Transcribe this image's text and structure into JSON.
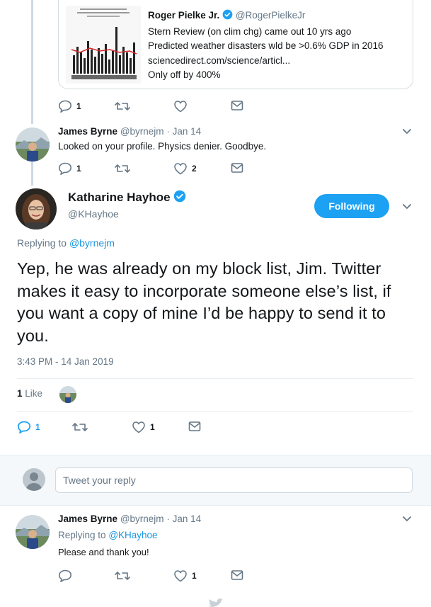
{
  "quoted_tweet": {
    "name": "Roger Pielke Jr.",
    "handle": "@RogerPielkeJr",
    "lines": [
      "Stern Review (on clim chg) came out 10 yrs ago",
      "Predicted weather disasters wld be >0.6% GDP in 2016",
      "sciencedirect.com/science/articl...",
      "Only off by 400%"
    ],
    "thumbnail_icon": "bar-chart-thumbnail"
  },
  "quote_actions": {
    "replies": "1",
    "retweets": "",
    "likes": ""
  },
  "reply_tweet": {
    "name": "James Byrne",
    "handle": "@byrnejm",
    "date": "· Jan 14",
    "text": "Looked on your profile. Physics denier. Goodbye.",
    "replies": "1",
    "likes": "2"
  },
  "main_tweet": {
    "name": "Katharine Hayhoe",
    "handle": "@KHayhoe",
    "follow_label": "Following",
    "replying_prefix": "Replying to",
    "replying_to": "@byrnejm",
    "text": "Yep, he was already on my block list, Jim. Twitter makes it easy to incorporate someone else’s list, if you want a copy of mine I’d be happy to send it to you.",
    "timestamp": "3:43 PM - 14 Jan 2019",
    "likes_count": "1",
    "likes_label": "Like",
    "replies": "1",
    "likes": "1"
  },
  "reply_box": {
    "placeholder": "Tweet your reply"
  },
  "bottom_tweet": {
    "name": "James Byrne",
    "handle": "@byrnejm",
    "date": "· Jan 14",
    "replying_prefix": "Replying to",
    "replying_to": "@KHayhoe",
    "text": "Please and thank you!",
    "likes": "1"
  },
  "colors": {
    "accent": "#1da1f2",
    "link": "#1b95e0",
    "muted": "#657786",
    "text": "#14171a",
    "thread_line": "#cdd9e3"
  }
}
